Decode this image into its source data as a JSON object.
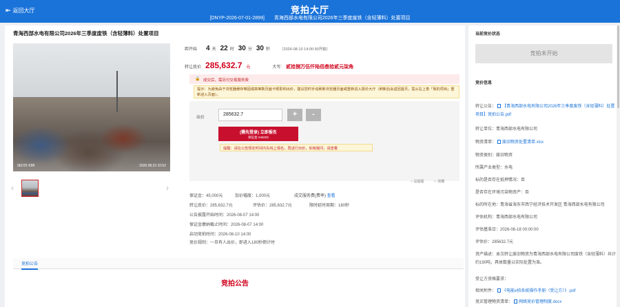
{
  "header": {
    "exit_label": "返回大厅",
    "title": "竞拍大厅",
    "code": "[DNYP-2026-07-01-2899]",
    "project": "青海西部水电有限公司2026年三季度废铁（含轻薄料）处置项目"
  },
  "project": {
    "title": "青海西部水电有限公司2026年三季度废铁（含轻薄料）处置项目"
  },
  "photo": {
    "stamp_left": "9ED日·K88",
    "stamp_right": "2026.08.23 10:52"
  },
  "countdown": {
    "label": "距开始",
    "days": "4",
    "days_unit": "天",
    "hours": "22",
    "hours_unit": "时",
    "minutes": "30",
    "minutes_unit": "分",
    "seconds": "30",
    "seconds_unit": "秒",
    "start_note": "（2026-08-10 14:00:30开始）"
  },
  "price": {
    "label": "转让底价",
    "value": "285,632.7",
    "unit": "元",
    "caps_label": "大写:",
    "caps": "贰拾捌万伍仟陆佰叁拾贰元柒角"
  },
  "warning": "成交后，需另付交易服务费",
  "notice": "提示：为避免由于浏览器缓存等因或高等数页面卡顿影响出价，建议您时手动刷新浏览器页面或重新进入报价大厅（刷新后会返回首页，需从右上角「我的项目」重新进入页面）。",
  "bid": {
    "label": "出价",
    "value": "285632.7",
    "plus": "+",
    "minus": "-",
    "signup_l1": "(需先登录) 立即报名",
    "signup_l2": "保证金 ¥45000",
    "hint": "提醒：请在公告规定时间内先线上报名，再进行出价，如有疑问，请查看"
  },
  "links": {
    "remind": "○ 设提醒",
    "fav": "☆ 收藏"
  },
  "info": {
    "deposit": "保证金：45,000元",
    "increment": "加价幅度：1,000元",
    "fee_label": "成交服务费(费率)",
    "fee_link": "查看",
    "reserve": "转让底价：285,632.7元",
    "appraise": "评估价：285,632.7元",
    "delay": "限时延时周期：180秒",
    "publish": "公告披露开始时间：2026-08-07 14:00",
    "deadline": "保证金缴纳截止时间：2026-08-07 14:00",
    "start": "启动竞拍时间：2026-08-10 14:00",
    "rule": "竞价规则：一旦有人出价，即进入180秒倒计时"
  },
  "tabs": {
    "active": "竞拍公告"
  },
  "section_title": "竞拍公告",
  "side": {
    "status_title": "当前竞价状态",
    "status": "竞拍未开始",
    "section": "竞价信息",
    "announce_label": "转让公告：",
    "announce_link": "【青海西部水电有限公司2026年三季度废铁（含轻薄料）处置项目】竞拍公告.pdf",
    "seller": "转让单位：青海西部水电有限公司",
    "list_label": "物资清单：",
    "list_link": "废旧物资处置清单.xlsx",
    "category": "物资类别：废旧物资",
    "industry": "所属产业类型：水电",
    "pledge": "标的是否存在抵押情况：否",
    "pollution": "是否存在环境污染物资产：否",
    "location": "标的所在地：青海省海东市西宁经济技术开发区 青海西部水电有限公司",
    "appraiser": "评估机构：青海西部水电有限公司",
    "appraise_date": "评估基准日：2026-06-18 00:00:00",
    "appraise_value": "评估价：285632.7元",
    "desc": "资产描述：本次转让废旧物资为青海西部水电有限公司废铁（含轻薄料）共计约190吨，具体数量以实际处置为准。",
    "qualification": "受让方资格要求：",
    "attach_label": "相关附件：",
    "attach_link": "《电能e拍系统操作手册（受让方）》.pdf",
    "list2_label": "竞买管理物资清单：",
    "list2_link": "网络竞价管理制度.docx"
  }
}
